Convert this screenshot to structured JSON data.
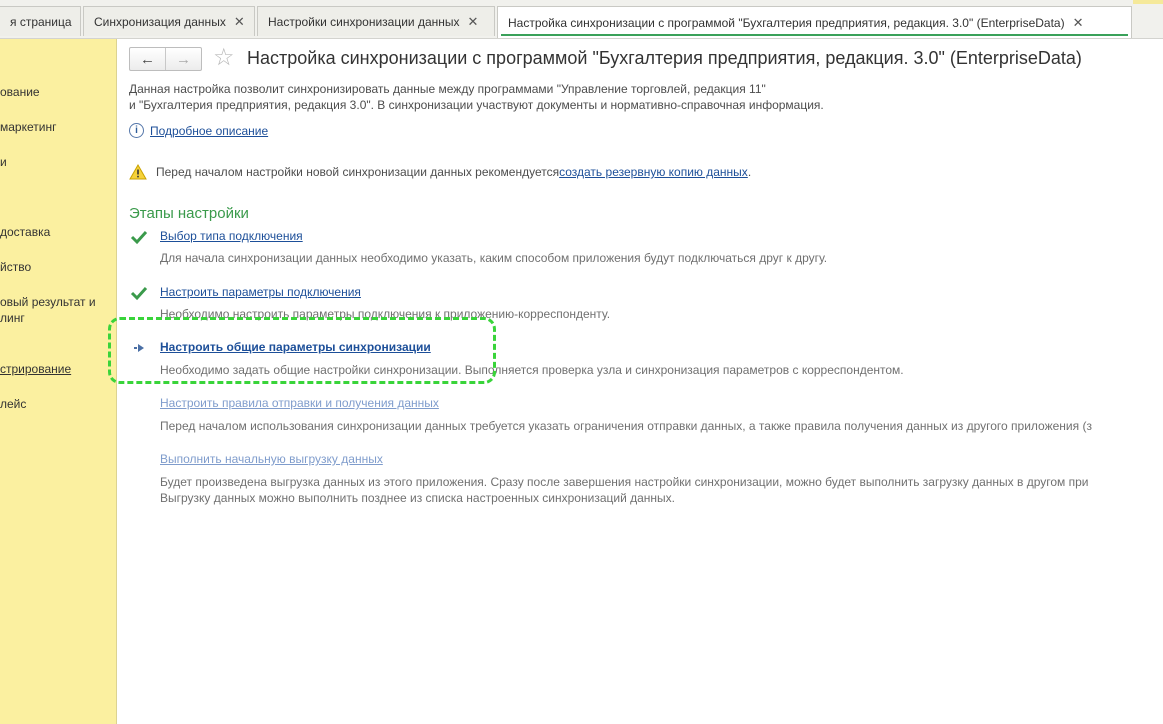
{
  "tabs": [
    {
      "label": "я страница",
      "closable": false
    },
    {
      "label": "Синхронизация данных",
      "closable": true
    },
    {
      "label": "Настройки синхронизации данных",
      "closable": true
    },
    {
      "label": "Настройка синхронизации с программой \"Бухгалтерия предприятия, редакция. 3.0\" (EnterpriseData)",
      "closable": true,
      "active": true
    }
  ],
  "close_glyph": "✕",
  "sidebar": {
    "items": [
      {
        "label": "ование"
      },
      {
        "label": "маркетинг"
      },
      {
        "label": "и"
      },
      {
        "label": " доставка"
      },
      {
        "label": "йство"
      },
      {
        "label": "овый результат и"
      },
      {
        "label": "линг"
      },
      {
        "label": "стрирование",
        "link": true
      },
      {
        "label": "лейс"
      }
    ]
  },
  "nav": {
    "back": "←",
    "forward": "→",
    "favorite_icon": "star-icon"
  },
  "page": {
    "title": "Настройка синхронизации с программой \"Бухгалтерия предприятия, редакция. 3.0\" (EnterpriseData)",
    "description_line1": "Данная настройка позволит синхронизировать данные между программами \"Управление торговлей, редакция 11\"",
    "description_line2": "и \"Бухгалтерия предприятия, редакция 3.0\".  В синхронизации участвуют документы и нормативно-справочная информация.",
    "info_icon_glyph": "i",
    "details_link": "Подробное описание",
    "warning_text": "Перед началом настройки новой синхронизации данных рекомендуется ",
    "warning_link": "создать резервную копию данных",
    "warning_end": ".",
    "stages_title": "Этапы настройки"
  },
  "steps": [
    {
      "status": "done",
      "icon": "checkmark-icon",
      "label": "Выбор типа подключения",
      "desc1": "Для начала синхронизации данных необходимо указать, каким способом приложения будут подключаться друг к другу.",
      "desc2": ""
    },
    {
      "status": "done",
      "icon": "checkmark-icon",
      "label": "Настроить параметры подключения",
      "desc1": "Необходимо настроить параметры подключения к приложению-корреспонденту.",
      "desc2": ""
    },
    {
      "status": "current",
      "icon": "current-step-arrow-icon",
      "label": "Настроить общие параметры синхронизации",
      "desc1": "Необходимо задать общие настройки синхронизации. Выполняется проверка узла и синхронизация параметров с корреспондентом.",
      "desc2": ""
    },
    {
      "status": "pending",
      "icon": "",
      "label": "Настроить правила отправки и получения данных",
      "desc1": "Перед началом использования синхронизации данных требуется указать ограничения отправки данных, а также правила получения данных из другого приложения (з",
      "desc2": ""
    },
    {
      "status": "pending",
      "icon": "",
      "label": "Выполнить начальную выгрузку данных",
      "desc1": "Будет произведена выгрузка данных из этого приложения. Сразу после завершения настройки синхронизации, можно будет выполнить загрузку данных в другом при",
      "desc2": "Выгрузку данных можно выполнить позднее из списка настроенных синхронизаций данных."
    }
  ],
  "colors": {
    "accent_green": "#3a9a4b",
    "link_blue": "#1d4f99",
    "sidebar_bg": "#fbf0a0",
    "highlight_dash": "#39d43a"
  }
}
